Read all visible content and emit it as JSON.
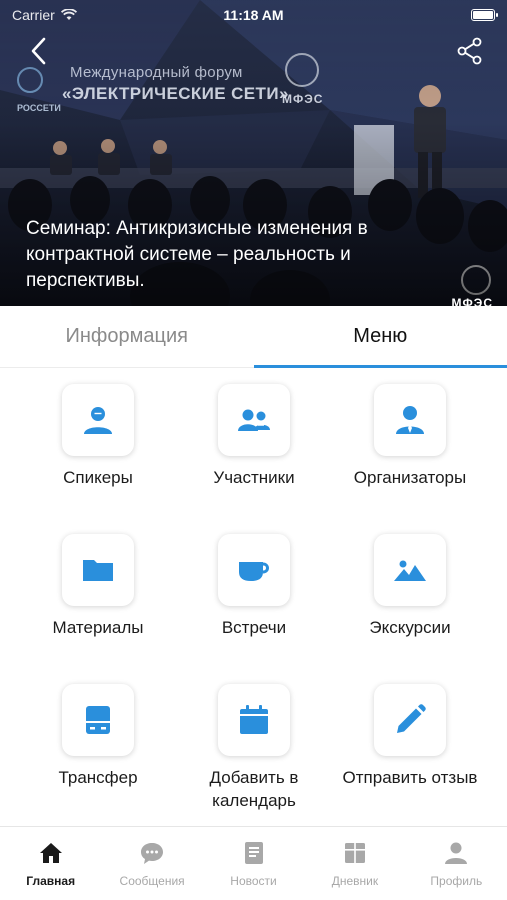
{
  "status_bar": {
    "carrier": "Carrier",
    "time": "11:18 AM"
  },
  "hero": {
    "banner_line1": "Международный форум",
    "banner_line2": "«ЭЛЕКТРИЧЕСКИЕ СЕТИ»",
    "banner_brand": "МФЭС",
    "banner_rosseti": "РОССЕТИ",
    "corner_brand": "МФЭС",
    "title": "Семинар: Антикризисные изменения в контрактной системе – реальность и перспективы."
  },
  "tabs": [
    {
      "label": "Информация",
      "active": false
    },
    {
      "label": "Меню",
      "active": true
    }
  ],
  "menu": [
    {
      "label": "Спикеры",
      "icon": "speaker-icon"
    },
    {
      "label": "Участники",
      "icon": "participants-icon"
    },
    {
      "label": "Организаторы",
      "icon": "organizer-icon"
    },
    {
      "label": "Материалы",
      "icon": "folder-icon"
    },
    {
      "label": "Встречи",
      "icon": "cup-icon"
    },
    {
      "label": "Экскурсии",
      "icon": "landscape-icon"
    },
    {
      "label": "Трансфер",
      "icon": "transfer-icon"
    },
    {
      "label": "Добавить в календарь",
      "icon": "calendar-icon"
    },
    {
      "label": "Отправить отзыв",
      "icon": "pencil-icon"
    }
  ],
  "bottom_nav": [
    {
      "label": "Главная",
      "icon": "home-icon",
      "active": true
    },
    {
      "label": "Сообщения",
      "icon": "chat-icon",
      "active": false
    },
    {
      "label": "Новости",
      "icon": "news-icon",
      "active": false
    },
    {
      "label": "Дневник",
      "icon": "diary-icon",
      "active": false
    },
    {
      "label": "Профиль",
      "icon": "profile-icon",
      "active": false
    }
  ],
  "colors": {
    "accent": "#2a8fdc",
    "icon_blue": "#2a8fdc",
    "nav_inactive": "#a8a8a8"
  }
}
